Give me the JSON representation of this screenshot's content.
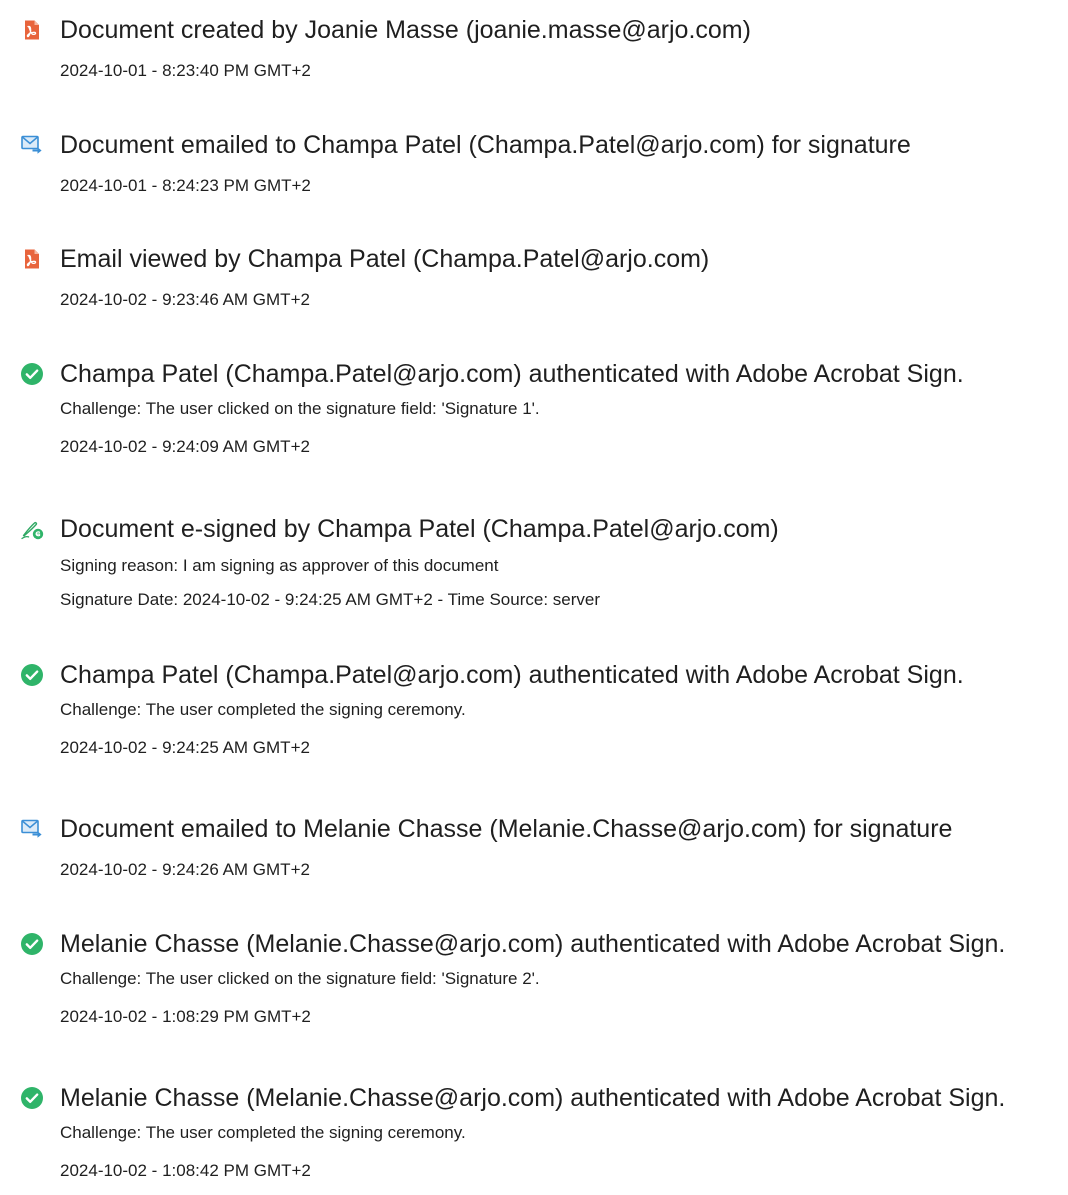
{
  "events": [
    {
      "icon": "pdf-document-icon",
      "title": "Document created by Joanie Masse (joanie.masse@arjo.com)",
      "lines": [
        "2024-10-01 - 8:23:40 PM GMT+2"
      ]
    },
    {
      "icon": "email-sent-icon",
      "title": "Document emailed to Champa Patel (Champa.Patel@arjo.com) for signature",
      "lines": [
        "2024-10-01 - 8:24:23 PM GMT+2"
      ]
    },
    {
      "icon": "pdf-document-icon",
      "title": "Email viewed by Champa Patel (Champa.Patel@arjo.com)",
      "lines": [
        "2024-10-02 - 9:23:46 AM GMT+2"
      ]
    },
    {
      "icon": "check-circle-icon",
      "title": "Champa Patel (Champa.Patel@arjo.com) authenticated with Adobe Acrobat Sign.",
      "lines": [
        "Challenge: The user clicked on the signature field: 'Signature 1'.",
        "2024-10-02 - 9:24:09 AM GMT+2"
      ]
    },
    {
      "icon": "e-sign-pen-icon",
      "title": "Document e-signed by Champa Patel (Champa.Patel@arjo.com)",
      "lines": [
        "Signing reason: I am signing as approver of this document",
        "Signature Date: 2024-10-02 - 9:24:25 AM GMT+2 - Time Source: server"
      ]
    },
    {
      "icon": "check-circle-icon",
      "title": "Champa Patel (Champa.Patel@arjo.com) authenticated with Adobe Acrobat Sign.",
      "lines": [
        "Challenge: The user completed the signing ceremony.",
        "2024-10-02 - 9:24:25 AM GMT+2"
      ]
    },
    {
      "icon": "email-sent-icon",
      "title": "Document emailed to Melanie Chasse (Melanie.Chasse@arjo.com) for signature",
      "lines": [
        "2024-10-02 - 9:24:26 AM GMT+2"
      ]
    },
    {
      "icon": "check-circle-icon",
      "title": "Melanie Chasse (Melanie.Chasse@arjo.com) authenticated with Adobe Acrobat Sign.",
      "lines": [
        "Challenge: The user clicked on the signature field: 'Signature 2'.",
        "2024-10-02 - 1:08:29 PM GMT+2"
      ]
    },
    {
      "icon": "check-circle-icon",
      "title": "Melanie Chasse (Melanie.Chasse@arjo.com) authenticated with Adobe Acrobat Sign.",
      "lines": [
        "Challenge: The user completed the signing ceremony.",
        "2024-10-02 - 1:08:42 PM GMT+2"
      ]
    }
  ],
  "colors": {
    "pdf_icon": "#e8643c",
    "email_icon": "#3b8fd6",
    "check_icon": "#2fb469",
    "sign_pen": "#2fa864",
    "sign_badge": "#2fb469",
    "text": "#1f1f1f"
  }
}
